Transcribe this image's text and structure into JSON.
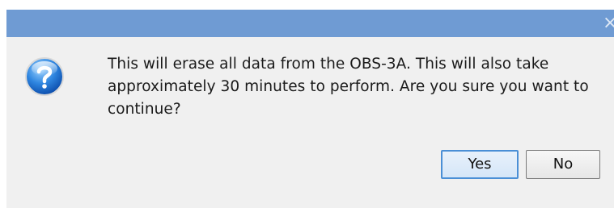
{
  "dialog": {
    "close_glyph": "×",
    "icon": "question-icon",
    "message": "This will erase all data from the OBS-3A. This will also take approximately 30 minutes to perform. Are you sure you want to continue?",
    "buttons": {
      "yes_label": "Yes",
      "no_label": "No"
    }
  },
  "colors": {
    "titlebar": "#6f9bd3",
    "dialog_background": "#f0f0f0",
    "default_button_border": "#4a8fd6"
  }
}
